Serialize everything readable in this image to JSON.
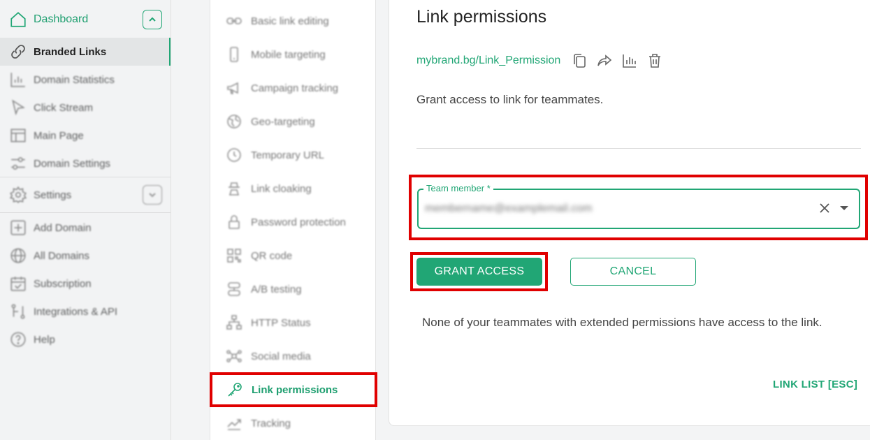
{
  "sidebar": {
    "dashboard_label": "Dashboard",
    "active_label": "Branded Links",
    "items": [
      {
        "label": "Domain Statistics",
        "icon": "chart-icon"
      },
      {
        "label": "Click Stream",
        "icon": "cursor-icon"
      },
      {
        "label": "Main Page",
        "icon": "layout-icon"
      },
      {
        "label": "Domain Settings",
        "icon": "sliders-icon"
      }
    ],
    "settings_label": "Settings",
    "bottom_items": [
      {
        "label": "Add Domain",
        "icon": "plus-box-icon"
      },
      {
        "label": "All Domains",
        "icon": "globe-icon"
      },
      {
        "label": "Subscription",
        "icon": "calendar-check-icon"
      },
      {
        "label": "Integrations & API",
        "icon": "integration-icon"
      },
      {
        "label": "Help",
        "icon": "help-icon"
      }
    ]
  },
  "menu": {
    "items": [
      {
        "label": "Basic link editing"
      },
      {
        "label": "Mobile targeting"
      },
      {
        "label": "Campaign tracking"
      },
      {
        "label": "Geo-targeting"
      },
      {
        "label": "Temporary URL"
      },
      {
        "label": "Link cloaking"
      },
      {
        "label": "Password protection"
      },
      {
        "label": "QR code"
      },
      {
        "label": "A/B testing"
      },
      {
        "label": "HTTP Status"
      },
      {
        "label": "Social media"
      }
    ],
    "active_label": "Link permissions",
    "last_label": "Tracking"
  },
  "main": {
    "title": "Link permissions",
    "short_link": "mybrand.bg/Link_Permission",
    "description": "Grant access to link for teammates.",
    "field_label": "Team member *",
    "field_value": "membername@examplemail.com",
    "grant_label": "GRANT ACCESS",
    "cancel_label": "CANCEL",
    "note": "None of your teammates with extended permissions have access to the link.",
    "link_list_label": "LINK LIST [ESC]"
  },
  "colors": {
    "accent": "#21a675",
    "highlight": "#e00000"
  }
}
